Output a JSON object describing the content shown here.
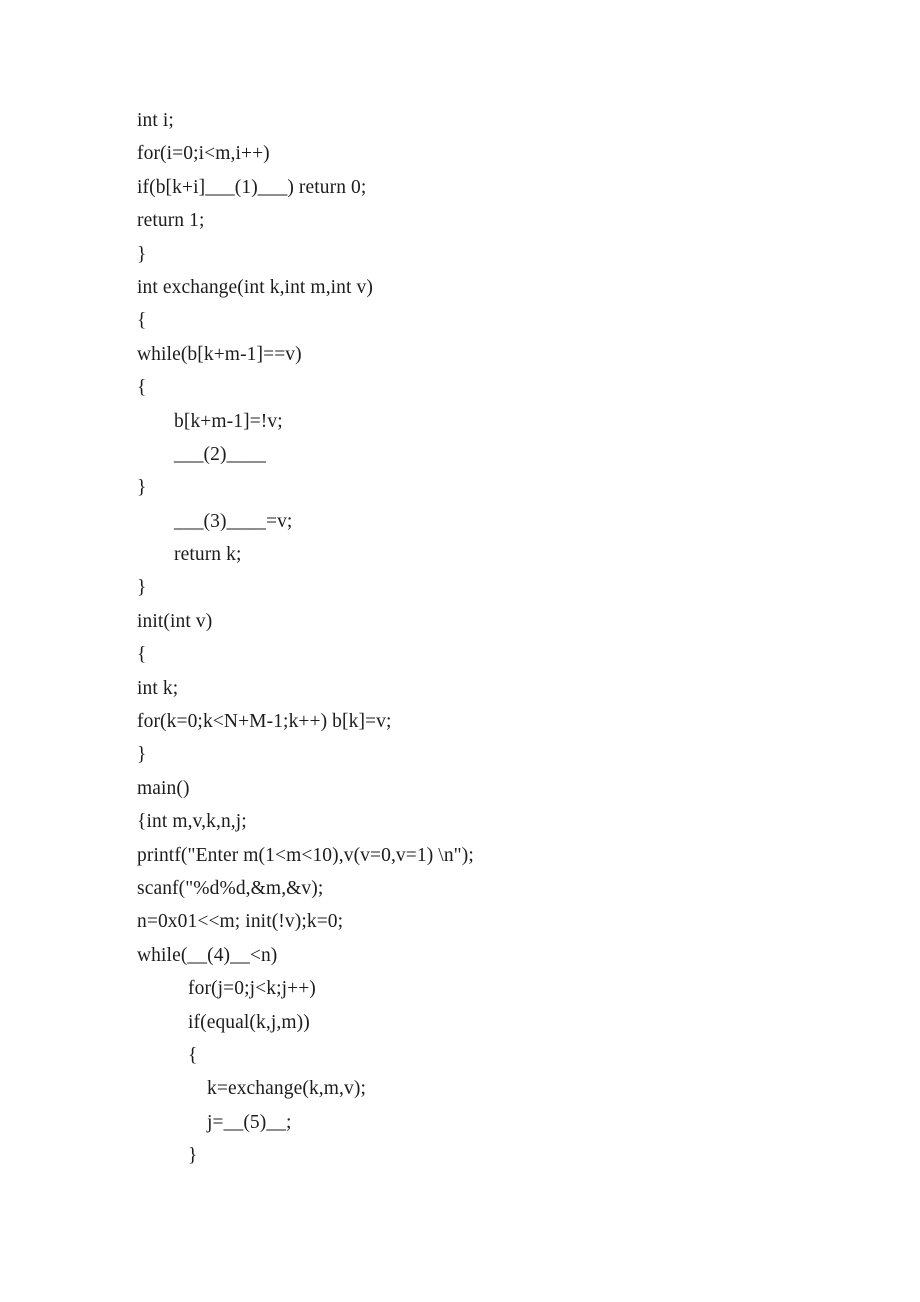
{
  "document": {
    "page_background": "#ffffff",
    "text_color": "#1c1c1c",
    "code_listing": {
      "language": "c",
      "description": "C source-code fill-in-the-blank exercise with five numbered blanks",
      "blanks": [
        "(1)",
        "(2)",
        "(3)",
        "(4)",
        "(5)"
      ],
      "lines": [
        {
          "indent": 0,
          "text": "int i;"
        },
        {
          "indent": 0,
          "text": "for(i=0;i<m,i++)"
        },
        {
          "indent": 0,
          "text": "if(b[k+i]___(1)___) return 0;"
        },
        {
          "indent": 0,
          "text": "return 1;"
        },
        {
          "indent": 0,
          "text": "}"
        },
        {
          "indent": 0,
          "text": "int exchange(int k,int m,int v)"
        },
        {
          "indent": 0,
          "text": "{"
        },
        {
          "indent": 0,
          "text": "while(b[k+m-1]==v)"
        },
        {
          "indent": 0,
          "text": "{"
        },
        {
          "indent": 1,
          "text": "b[k+m-1]=!v;"
        },
        {
          "indent": 1,
          "text": "___(2)____"
        },
        {
          "indent": 0,
          "text": "}"
        },
        {
          "indent": 1,
          "text": "___(3)____=v;"
        },
        {
          "indent": 1,
          "text": "return k;"
        },
        {
          "indent": 0,
          "text": "}"
        },
        {
          "indent": 0,
          "text": "init(int v)"
        },
        {
          "indent": 0,
          "text": "{"
        },
        {
          "indent": 0,
          "text": "int k;"
        },
        {
          "indent": 0,
          "text": "for(k=0;k<N+M-1;k++) b[k]=v;"
        },
        {
          "indent": 0,
          "text": "}"
        },
        {
          "indent": 0,
          "text": "main()"
        },
        {
          "indent": 0,
          "text": "{int m,v,k,n,j;"
        },
        {
          "indent": 0,
          "text": "printf(\"Enter m(1<m<10),v(v=0,v=1) \\n\");"
        },
        {
          "indent": 0,
          "text": "scanf(\"%d%d,&m,&v);"
        },
        {
          "indent": 0,
          "text": "n=0x01<<m; init(!v);k=0;"
        },
        {
          "indent": 0,
          "text": "while(__(4)__<n)"
        },
        {
          "indent": 2,
          "text": "for(j=0;j<k;j++)"
        },
        {
          "indent": 2,
          "text": "if(equal(k,j,m))"
        },
        {
          "indent": 2,
          "text": "{"
        },
        {
          "indent": 3,
          "text": "k=exchange(k,m,v);"
        },
        {
          "indent": 3,
          "text": "j=__(5)__;"
        },
        {
          "indent": 2,
          "text": "}"
        }
      ]
    }
  }
}
